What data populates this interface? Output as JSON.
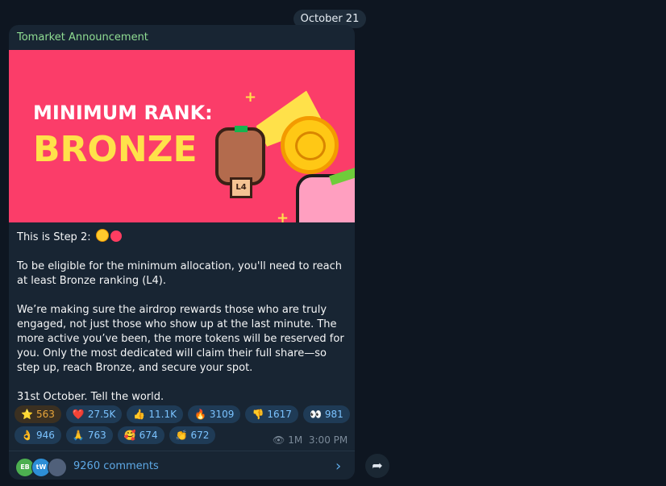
{
  "date_separator": "October 21",
  "channel_name": "Tomarket Announcement",
  "banner": {
    "line1": "MINIMUM RANK:",
    "line2": "BRONZE",
    "badge_label": "L4"
  },
  "message": {
    "step_text": "This is Step 2:",
    "paragraph2": "To be eligible for the minimum allocation, you'll need to reach at least Bronze ranking (L4).",
    "paragraph3": "We’re making sure the airdrop rewards those who are truly engaged, not just those who show up at the last minute. The more active you’ve been, the more tokens will be reserved for you. Only the most dedicated will claim their full share—so step up, reach Bronze, and secure your spot.",
    "paragraph4": "31st October. Tell the world."
  },
  "reactions": {
    "row1": [
      {
        "emoji": "⭐",
        "count": "563",
        "icon_name": "star-icon"
      },
      {
        "emoji": "❤️",
        "count": "27.5K",
        "icon_name": "heart-icon"
      },
      {
        "emoji": "👍",
        "count": "11.1K",
        "icon_name": "thumbs-up-icon"
      },
      {
        "emoji": "🔥",
        "count": "3109",
        "icon_name": "fire-icon"
      },
      {
        "emoji": "👎",
        "count": "1617",
        "icon_name": "thumbs-down-icon"
      },
      {
        "emoji": "👀",
        "count": "981",
        "icon_name": "eyes-icon"
      }
    ],
    "row2": [
      {
        "emoji": "👌",
        "count": "946",
        "icon_name": "ok-hand-icon"
      },
      {
        "emoji": "🙏",
        "count": "763",
        "icon_name": "pray-icon"
      },
      {
        "emoji": "🥰",
        "count": "674",
        "icon_name": "smiling-face-hearts-icon"
      },
      {
        "emoji": "👏",
        "count": "672",
        "icon_name": "clap-icon"
      }
    ]
  },
  "meta": {
    "views": "1M",
    "time": "3:00 PM"
  },
  "comments": {
    "count_text": "9260 comments",
    "avatars": [
      "EB",
      "tW",
      ""
    ]
  },
  "colors": {
    "banner_bg": "#fb3d69",
    "accent_yellow": "#ffe14a",
    "channel_name_green": "#8fdc92",
    "link_blue": "#5ea9e6"
  }
}
